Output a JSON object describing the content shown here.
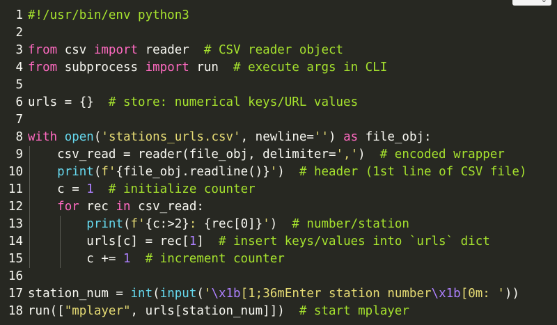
{
  "toolbar": {
    "menu_icon": "chevron-down-icon",
    "menu_glyph": "⌄"
  },
  "colors": {
    "background": "#272822",
    "default": "#f8f8f2",
    "keyword": "#ff6ac1",
    "builtin": "#66d9ef",
    "string": "#e6db74",
    "comment": "#a6e22e",
    "number": "#ae81ff",
    "escape": "#ae81ff"
  },
  "lines": [
    {
      "n": "1",
      "indent": 0,
      "tokens": [
        {
          "t": "#!/usr/bin/env python3",
          "c": "comment"
        }
      ]
    },
    {
      "n": "2",
      "indent": 0,
      "tokens": []
    },
    {
      "n": "3",
      "indent": 0,
      "tokens": [
        {
          "t": "from",
          "c": "keyword"
        },
        {
          "t": " csv ",
          "c": "default"
        },
        {
          "t": "import",
          "c": "keyword"
        },
        {
          "t": " reader  ",
          "c": "default"
        },
        {
          "t": "# CSV reader object",
          "c": "comment"
        }
      ]
    },
    {
      "n": "4",
      "indent": 0,
      "tokens": [
        {
          "t": "from",
          "c": "keyword"
        },
        {
          "t": " subprocess ",
          "c": "default"
        },
        {
          "t": "import",
          "c": "keyword"
        },
        {
          "t": " run  ",
          "c": "default"
        },
        {
          "t": "# execute args in CLI",
          "c": "comment"
        }
      ]
    },
    {
      "n": "5",
      "indent": 0,
      "tokens": []
    },
    {
      "n": "6",
      "indent": 0,
      "tokens": [
        {
          "t": "urls = {}  ",
          "c": "default"
        },
        {
          "t": "# store: numerical keys/URL values",
          "c": "comment"
        }
      ]
    },
    {
      "n": "7",
      "indent": 0,
      "tokens": []
    },
    {
      "n": "8",
      "indent": 0,
      "tokens": [
        {
          "t": "with",
          "c": "keyword"
        },
        {
          "t": " ",
          "c": "default"
        },
        {
          "t": "open",
          "c": "builtin"
        },
        {
          "t": "(",
          "c": "default"
        },
        {
          "t": "'stations_urls.csv'",
          "c": "string"
        },
        {
          "t": ", newline=",
          "c": "default"
        },
        {
          "t": "''",
          "c": "string"
        },
        {
          "t": ") ",
          "c": "default"
        },
        {
          "t": "as",
          "c": "keyword"
        },
        {
          "t": " file_obj:",
          "c": "default"
        }
      ]
    },
    {
      "n": "9",
      "indent": 1,
      "tokens": [
        {
          "t": "    csv_read = reader(file_obj, delimiter=",
          "c": "default"
        },
        {
          "t": "','",
          "c": "string"
        },
        {
          "t": ")  ",
          "c": "default"
        },
        {
          "t": "# encoded wrapper",
          "c": "comment"
        }
      ]
    },
    {
      "n": "10",
      "indent": 1,
      "tokens": [
        {
          "t": "    ",
          "c": "default"
        },
        {
          "t": "print",
          "c": "builtin"
        },
        {
          "t": "(",
          "c": "default"
        },
        {
          "t": "f'",
          "c": "string"
        },
        {
          "t": "{file_obj.readline()}",
          "c": "default"
        },
        {
          "t": "'",
          "c": "string"
        },
        {
          "t": ")  ",
          "c": "default"
        },
        {
          "t": "# header (1st line of CSV file)",
          "c": "comment"
        }
      ]
    },
    {
      "n": "11",
      "indent": 1,
      "tokens": [
        {
          "t": "    c = ",
          "c": "default"
        },
        {
          "t": "1",
          "c": "number"
        },
        {
          "t": "  ",
          "c": "default"
        },
        {
          "t": "# initialize counter",
          "c": "comment"
        }
      ]
    },
    {
      "n": "12",
      "indent": 1,
      "tokens": [
        {
          "t": "    ",
          "c": "default"
        },
        {
          "t": "for",
          "c": "keyword"
        },
        {
          "t": " rec ",
          "c": "default"
        },
        {
          "t": "in",
          "c": "keyword"
        },
        {
          "t": " csv_read:",
          "c": "default"
        }
      ]
    },
    {
      "n": "13",
      "indent": 2,
      "tokens": [
        {
          "t": "        ",
          "c": "default"
        },
        {
          "t": "print",
          "c": "builtin"
        },
        {
          "t": "(",
          "c": "default"
        },
        {
          "t": "f'",
          "c": "string"
        },
        {
          "t": "{c:>2}",
          "c": "default"
        },
        {
          "t": ": ",
          "c": "string"
        },
        {
          "t": "{rec[0]}",
          "c": "default"
        },
        {
          "t": "'",
          "c": "string"
        },
        {
          "t": ")  ",
          "c": "default"
        },
        {
          "t": "# number/station",
          "c": "comment"
        }
      ]
    },
    {
      "n": "14",
      "indent": 2,
      "tokens": [
        {
          "t": "        urls[c] = rec[",
          "c": "default"
        },
        {
          "t": "1",
          "c": "number"
        },
        {
          "t": "]  ",
          "c": "default"
        },
        {
          "t": "# insert keys/values into `urls` dict",
          "c": "comment"
        }
      ]
    },
    {
      "n": "15",
      "indent": 2,
      "tokens": [
        {
          "t": "        c += ",
          "c": "default"
        },
        {
          "t": "1",
          "c": "number"
        },
        {
          "t": "  ",
          "c": "default"
        },
        {
          "t": "# increment counter",
          "c": "comment"
        }
      ]
    },
    {
      "n": "16",
      "indent": 0,
      "tokens": []
    },
    {
      "n": "17",
      "indent": 0,
      "tokens": [
        {
          "t": "station_num = ",
          "c": "default"
        },
        {
          "t": "int",
          "c": "builtin"
        },
        {
          "t": "(",
          "c": "default"
        },
        {
          "t": "input",
          "c": "builtin"
        },
        {
          "t": "(",
          "c": "default"
        },
        {
          "t": "'",
          "c": "string"
        },
        {
          "t": "\\x1b",
          "c": "escape"
        },
        {
          "t": "[1;36mEnter station number",
          "c": "string"
        },
        {
          "t": "\\x1b",
          "c": "escape"
        },
        {
          "t": "[0m: '",
          "c": "string"
        },
        {
          "t": "))",
          "c": "default"
        }
      ]
    },
    {
      "n": "18",
      "indent": 0,
      "tokens": [
        {
          "t": "run([",
          "c": "default"
        },
        {
          "t": "\"mplayer\"",
          "c": "string"
        },
        {
          "t": ", urls[station_num]])  ",
          "c": "default"
        },
        {
          "t": "# start mplayer",
          "c": "comment"
        }
      ]
    }
  ]
}
